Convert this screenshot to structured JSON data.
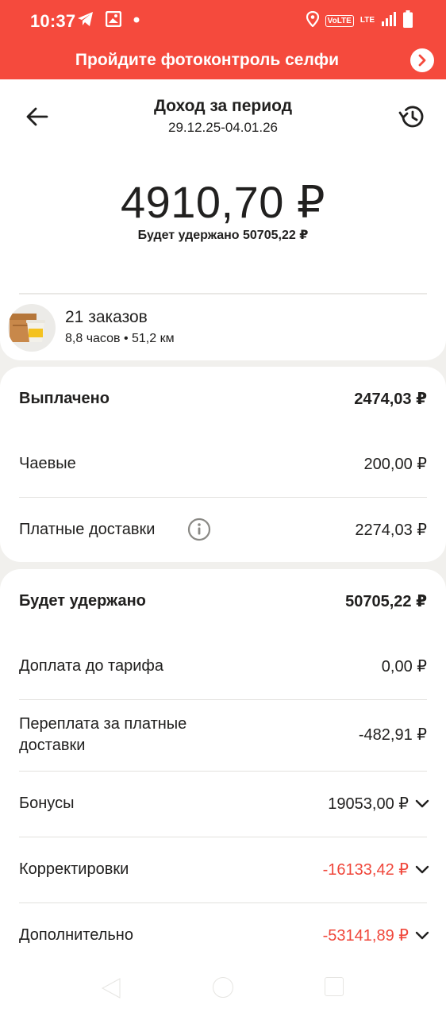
{
  "status_bar": {
    "time": "10:37",
    "lte_label": "LTE",
    "volte_label": "VoLTE",
    "icons": [
      "telegram-icon",
      "image-icon",
      "dot-icon",
      "location-icon",
      "volte-icon",
      "lte-icon",
      "signal-icon",
      "battery-icon"
    ]
  },
  "banner": {
    "text": "Пройдите фотоконтроль селфи"
  },
  "header": {
    "title": "Доход за период",
    "period": "29.12.25-04.01.26"
  },
  "summary": {
    "total": "4910,70 ₽",
    "withheld_note": "Будет удержано 50705,22 ₽"
  },
  "orders": {
    "count": "21 заказов",
    "details": "8,8 часов • 51,2 км"
  },
  "paid": {
    "title": "Выплачено",
    "total": "2474,03 ₽",
    "rows": [
      {
        "label": "Чаевые",
        "value": "200,00 ₽"
      },
      {
        "label": "Платные доставки",
        "value": "2274,03 ₽"
      }
    ]
  },
  "withheld": {
    "title": "Будет удержано",
    "total": "50705,22 ₽",
    "rows": [
      {
        "label": "Доплата до тарифа",
        "value": "0,00 ₽"
      },
      {
        "label": "Переплата за платные доставки",
        "value": "-482,91 ₽"
      },
      {
        "label": "Бонусы",
        "value": "19053,00 ₽"
      },
      {
        "label": "Корректировки",
        "value": "-16133,42 ₽"
      },
      {
        "label": "Дополнительно",
        "value": "-53141,89 ₽"
      }
    ]
  },
  "colors": {
    "accent": "#f54a3d",
    "negative": "#f0473b",
    "text": "#21201f",
    "background": "#f1f0ed"
  }
}
